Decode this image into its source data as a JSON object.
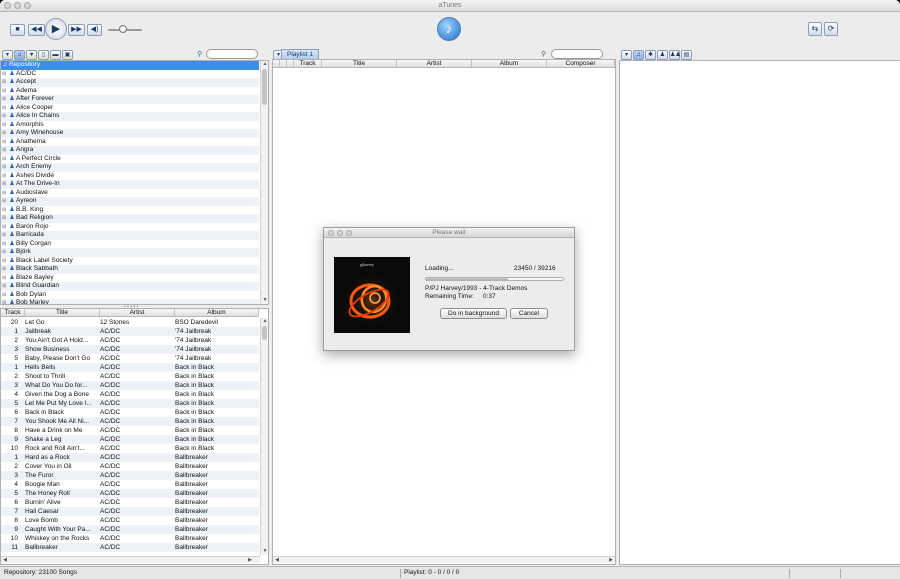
{
  "window": {
    "title": "aTunes"
  },
  "player": {
    "icons": [
      "stop-icon",
      "previous-icon",
      "play-icon",
      "next-icon",
      "volume-icon",
      "repeat-icon",
      "fullscreen-icon"
    ]
  },
  "navigator": {
    "search_placeholder": "",
    "repository_label": "Repository",
    "artists": [
      "AC/DC",
      "Accept",
      "Adema",
      "After Forever",
      "Alice Cooper",
      "Alice In Chains",
      "Amorphis",
      "Amy Winehouse",
      "Anathema",
      "Angra",
      "A Perfect Circle",
      "Arch Enemy",
      "Ashes Divide",
      "At The Drive-In",
      "Audioslave",
      "Ayreon",
      "B.B. King",
      "Bad Religion",
      "Barón Rojo",
      "Barricada",
      "Billy Corgan",
      "Björk",
      "Black Label Society",
      "Black Sabbath",
      "Blaze Bayley",
      "Blind Guardian",
      "Bob Dylan",
      "Bob Marley"
    ]
  },
  "songs_table": {
    "columns": [
      "Track",
      "Title",
      "Artist",
      "Album"
    ],
    "rows": [
      [
        "20",
        "Let Go",
        "12 Stones",
        "BSO Daredevil"
      ],
      [
        "1",
        "Jailbreak",
        "AC/DC",
        "'74 Jailbreak"
      ],
      [
        "2",
        "You Ain't Got A Hold...",
        "AC/DC",
        "'74 Jailbreak"
      ],
      [
        "3",
        "Show Business",
        "AC/DC",
        "'74 Jailbreak"
      ],
      [
        "5",
        "Baby, Please Don't Go",
        "AC/DC",
        "'74 Jailbreak"
      ],
      [
        "1",
        "Hells Bells",
        "AC/DC",
        "Back in Black"
      ],
      [
        "2",
        "Shoot to Thrill",
        "AC/DC",
        "Back in Black"
      ],
      [
        "3",
        "What Do You Do for...",
        "AC/DC",
        "Back in Black"
      ],
      [
        "4",
        "Given the Dog a Bone",
        "AC/DC",
        "Back in Black"
      ],
      [
        "5",
        "Let Me Put My Love I...",
        "AC/DC",
        "Back in Black"
      ],
      [
        "6",
        "Back in Black",
        "AC/DC",
        "Back in Black"
      ],
      [
        "7",
        "You Shook Me All Ni...",
        "AC/DC",
        "Back in Black"
      ],
      [
        "8",
        "Have a Drink on Me",
        "AC/DC",
        "Back in Black"
      ],
      [
        "9",
        "Shake a Leg",
        "AC/DC",
        "Back in Black"
      ],
      [
        "10",
        "Rock and Roll Ain't...",
        "AC/DC",
        "Back in Black"
      ],
      [
        "1",
        "Hard as a Rock",
        "AC/DC",
        "Ballbreaker"
      ],
      [
        "2",
        "Cover You in Oil",
        "AC/DC",
        "Ballbreaker"
      ],
      [
        "3",
        "The Furor",
        "AC/DC",
        "Ballbreaker"
      ],
      [
        "4",
        "Boogie Man",
        "AC/DC",
        "Ballbreaker"
      ],
      [
        "5",
        "The Honey Roll",
        "AC/DC",
        "Ballbreaker"
      ],
      [
        "6",
        "Burnin' Alive",
        "AC/DC",
        "Ballbreaker"
      ],
      [
        "7",
        "Hail Caesar",
        "AC/DC",
        "Ballbreaker"
      ],
      [
        "8",
        "Love Bomb",
        "AC/DC",
        "Ballbreaker"
      ],
      [
        "9",
        "Caught With Your Pa...",
        "AC/DC",
        "Ballbreaker"
      ],
      [
        "10",
        "Whiskey on the Rocks",
        "AC/DC",
        "Ballbreaker"
      ],
      [
        "11",
        "Ballbreaker",
        "AC/DC",
        "Ballbreaker"
      ]
    ]
  },
  "playlist": {
    "tab_label": "Playlist 1",
    "search_placeholder": "",
    "columns": [
      "Track",
      "Title",
      "Artist",
      "Album",
      "Composer"
    ]
  },
  "dialog": {
    "title": "Please wait",
    "loading_label": "Loading...",
    "loading_count": "23450  /  39216",
    "progress": 0.598,
    "current_item": "P/PJ Harvey/1993 - 4-Track Demos",
    "remaining_label": "Remaining Time:",
    "remaining_value": "0:37",
    "background_button": "Do in background",
    "cancel_button": "Cancel",
    "cover_text": "pjharvey"
  },
  "status": {
    "repository": "Repository: 23100 Songs",
    "playlist": "Playlist: 0 - 0 / 0 / 0"
  },
  "colors": {
    "selection": "#3d8ee6",
    "accent": "#1b6fc6",
    "row_stripe": "#edf1f8"
  }
}
